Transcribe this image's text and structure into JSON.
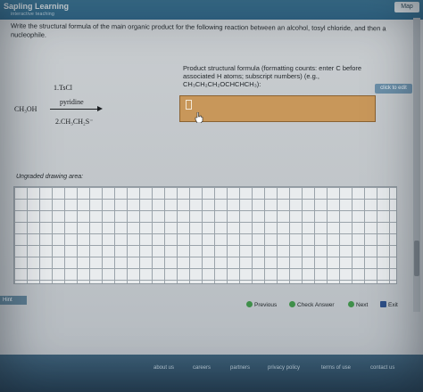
{
  "header": {
    "brand": "Sapling Learning",
    "brand_sub": "interactive teaching",
    "top_tab": "Map"
  },
  "question": {
    "text": "Write the structural formula of the main organic product for the following reaction between an alcohol, tosyl chloride, and then a nucleophile."
  },
  "reaction": {
    "starting_material": "CH₃OH",
    "reagent_1": "1.TsCl",
    "reagent_2": "pyridine",
    "reagent_3": "2.CH₃CH₂S⁻"
  },
  "answer": {
    "instructions": "Product structural formula (formatting counts: enter C before associated H atoms; subscript numbers) (e.g., CH₃CH₂CH₂OCHCHCH₃):",
    "edit_button": "click to edit",
    "value": ""
  },
  "drawing": {
    "label": "Ungraded drawing area:"
  },
  "nav": {
    "hint": "Hint",
    "previous": "Previous",
    "check_answer": "Check Answer",
    "next": "Next",
    "exit": "Exit"
  },
  "footer": {
    "links": [
      "about us",
      "careers",
      "partners",
      "privacy policy",
      "terms of use",
      "contact us"
    ]
  },
  "colors": {
    "answer_box": "#c8975a",
    "header_bar": "#2f6586"
  }
}
